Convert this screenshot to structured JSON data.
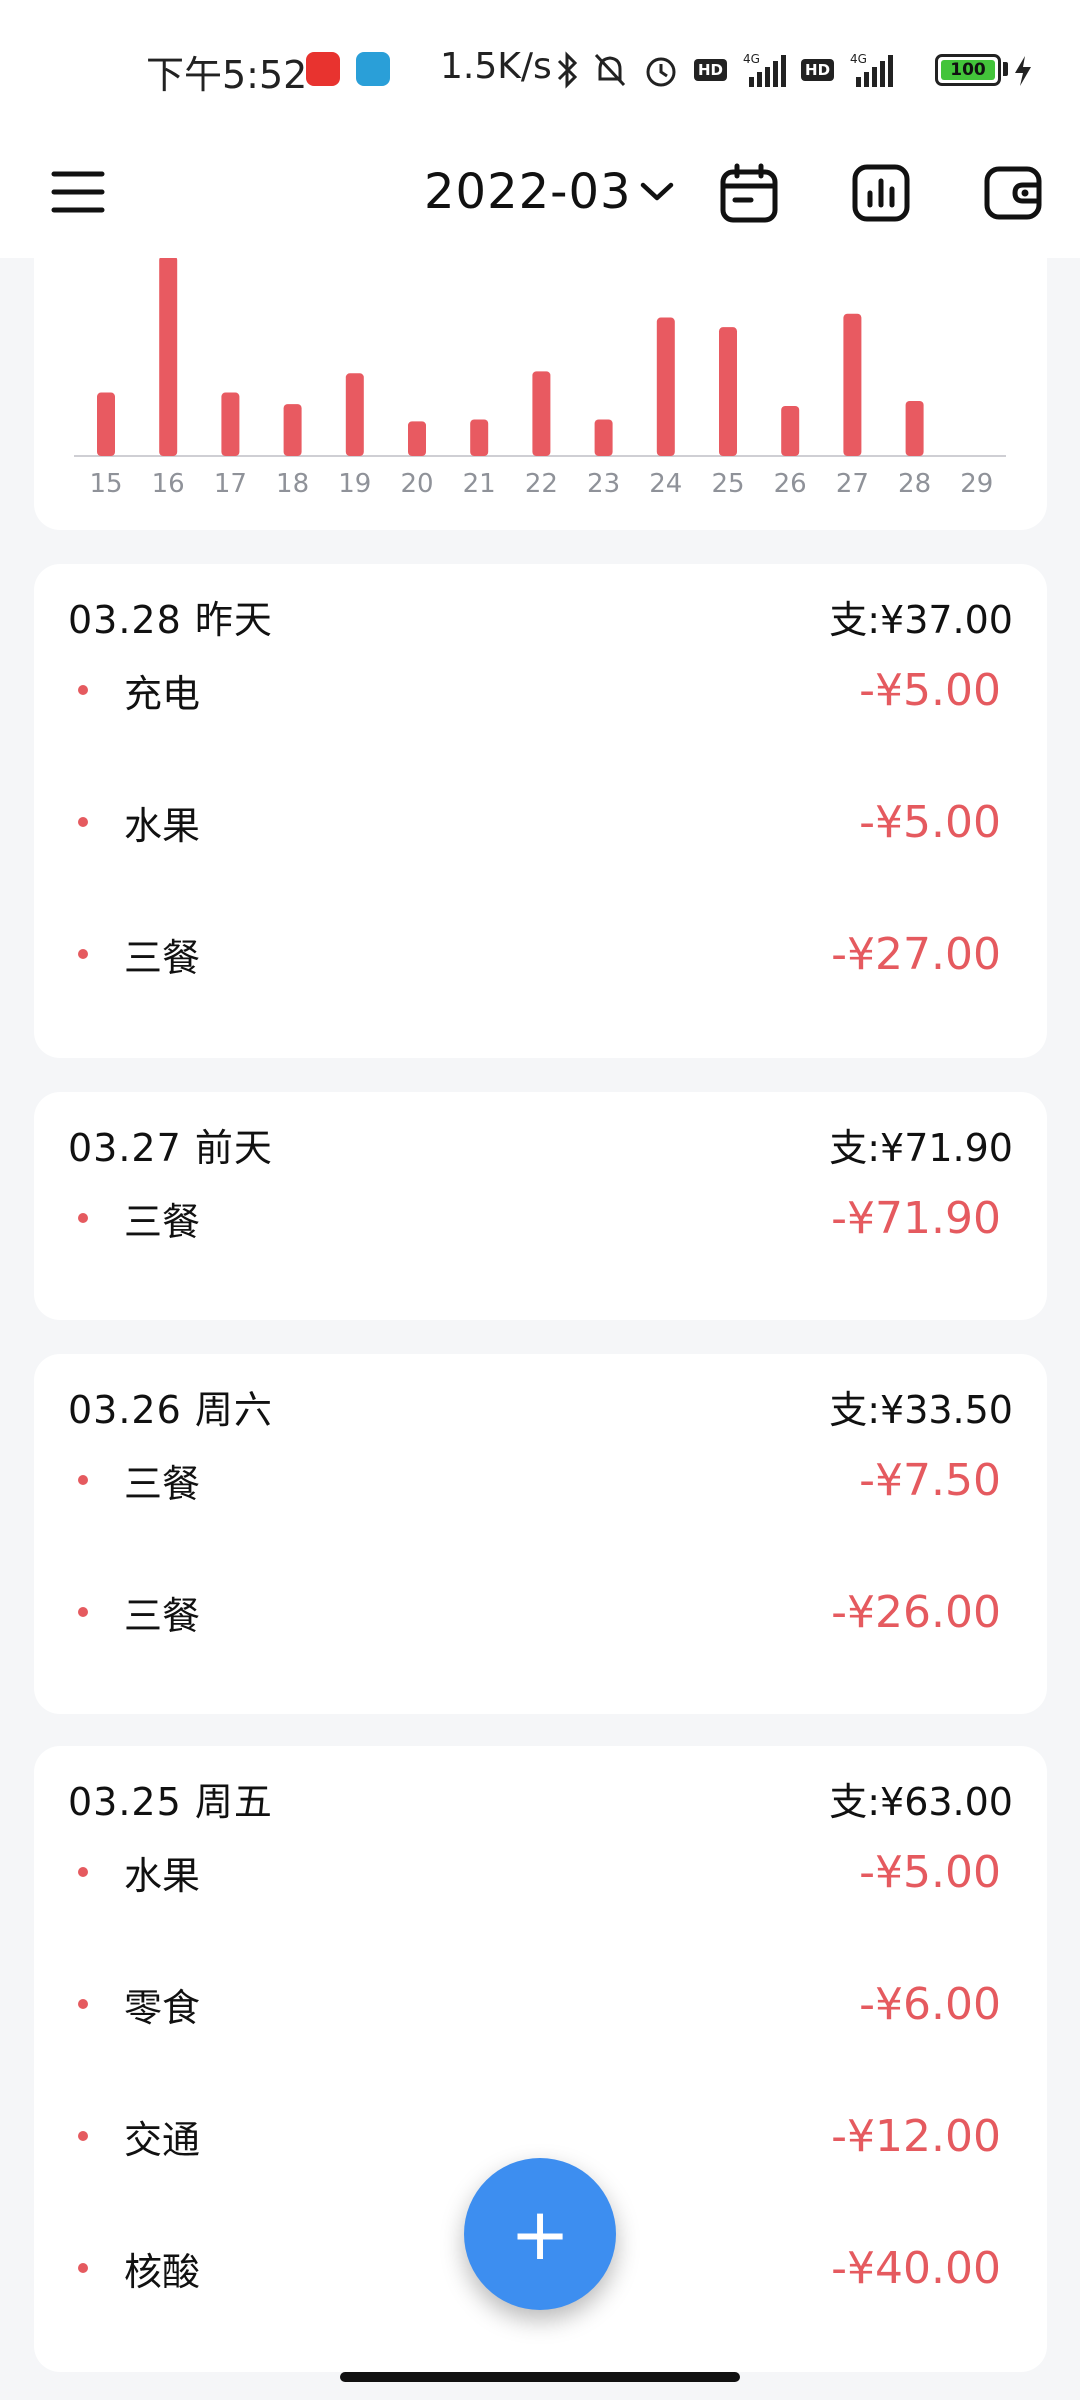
{
  "status_bar": {
    "time": "下午5:52",
    "net_speed": "1.5K/s",
    "battery_level": "100",
    "icons": [
      "netease-music-icon",
      "app-icon",
      "bluetooth-icon",
      "mute-icon",
      "alarm-icon",
      "hd-icon",
      "signal-4g-icon",
      "hd-icon",
      "signal-4g-icon",
      "battery-icon",
      "charging-icon"
    ],
    "hd_label": "HD",
    "network_type": "4G"
  },
  "app_bar": {
    "month": "2022-03",
    "icons": [
      "menu-icon",
      "calendar-icon",
      "stats-icon",
      "wallet-icon"
    ]
  },
  "chart_data": {
    "type": "bar",
    "categories": [
      "15",
      "16",
      "17",
      "18",
      "19",
      "20",
      "21",
      "22",
      "23",
      "24",
      "25",
      "26",
      "27",
      "28",
      "29"
    ],
    "values": [
      16.5,
      52,
      16.5,
      13.5,
      21.5,
      9,
      9.5,
      22,
      9.5,
      36,
      33.5,
      13,
      37,
      14.3,
      0
    ],
    "bar_color": "#e85a61",
    "xlabel": "",
    "ylabel": ""
  },
  "days": [
    {
      "date": "03.28  昨天",
      "total": "支:¥37.00",
      "entries": [
        {
          "label": "充电",
          "amount": "-¥5.00"
        },
        {
          "label": "水果",
          "amount": "-¥5.00"
        },
        {
          "label": "三餐",
          "amount": "-¥27.00"
        }
      ]
    },
    {
      "date": "03.27  前天",
      "total": "支:¥71.90",
      "entries": [
        {
          "label": "三餐",
          "amount": "-¥71.90"
        }
      ]
    },
    {
      "date": "03.26  周六",
      "total": "支:¥33.50",
      "entries": [
        {
          "label": "三餐",
          "amount": "-¥7.50"
        },
        {
          "label": "三餐",
          "amount": "-¥26.00"
        }
      ]
    },
    {
      "date": "03.25  周五",
      "total": "支:¥63.00",
      "entries": [
        {
          "label": "水果",
          "amount": "-¥5.00"
        },
        {
          "label": "零食",
          "amount": "-¥6.00"
        },
        {
          "label": "交通",
          "amount": "-¥12.00"
        },
        {
          "label": "核酸",
          "amount": "-¥40.00"
        }
      ]
    }
  ],
  "fab": {
    "icon": "plus-icon",
    "label": "+"
  },
  "colors": {
    "accent": "#3d8ef0",
    "expense": "#e55a5f",
    "background": "#f5f6f8"
  }
}
